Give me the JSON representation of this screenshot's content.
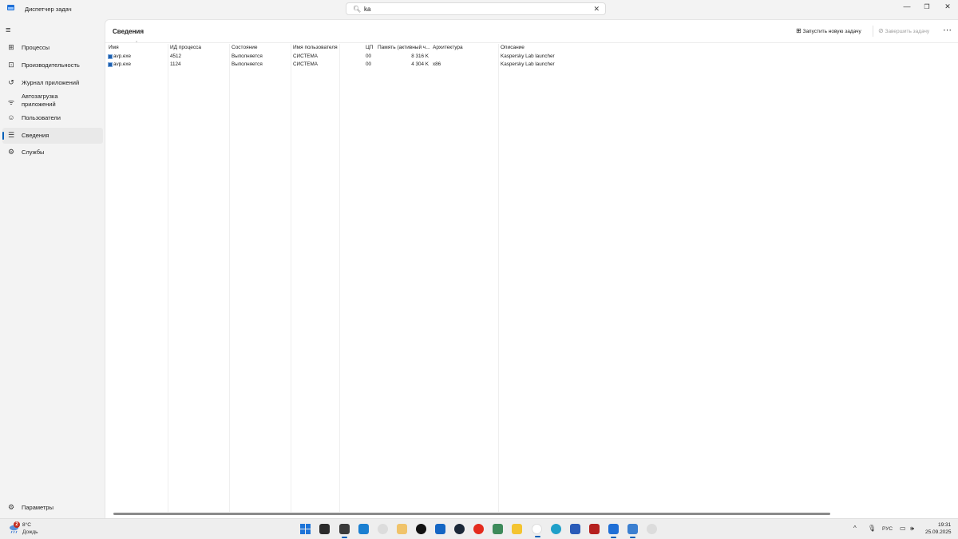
{
  "window": {
    "title": "Диспетчер задач",
    "search_value": "ka"
  },
  "sidebar": {
    "items": [
      {
        "label": "Процессы",
        "icon": "processes-icon"
      },
      {
        "label": "Производительность",
        "icon": "performance-icon"
      },
      {
        "label": "Журнал приложений",
        "icon": "app-history-icon"
      },
      {
        "label": "Автозагрузка приложений",
        "icon": "startup-apps-icon"
      },
      {
        "label": "Пользователи",
        "icon": "users-icon"
      },
      {
        "label": "Сведения",
        "icon": "details-icon",
        "active": true
      },
      {
        "label": "Службы",
        "icon": "services-icon"
      }
    ],
    "settings_label": "Параметры"
  },
  "main": {
    "title": "Сведения",
    "run_task_label": "Запустить новую задачу",
    "end_task_label": "Завершить задачу",
    "columns": [
      "Имя",
      "ИД процесса",
      "Состояние",
      "Имя пользователя",
      "ЦП",
      "Память (активный ч...",
      "Архитектура",
      "Описание"
    ],
    "rows": [
      {
        "name": "avp.exe",
        "pid": "4512",
        "status": "Выполняется",
        "user": "СИСТЕМА",
        "cpu": "00",
        "memory": "8 316 K",
        "arch": "",
        "desc": "Kaspersky Lab launcher"
      },
      {
        "name": "avp.exe",
        "pid": "1124",
        "status": "Выполняется",
        "user": "СИСТЕМА",
        "cpu": "00",
        "memory": "4 304 K",
        "arch": "x86",
        "desc": "Kaspersky Lab launcher"
      }
    ]
  },
  "taskbar": {
    "weather_badge": "2",
    "weather_temp": "8°C",
    "weather_desc": "Дождь",
    "language": "РУС",
    "time": "19:31",
    "date": "25.09.2025",
    "pinned": [
      "windows-start",
      "file-manager",
      "terminal",
      "notes",
      "panda",
      "folder-app",
      "tiktok",
      "store",
      "steam",
      "yandex",
      "game",
      "explorer",
      "yandex-browser",
      "edge",
      "save-app",
      "filezilla",
      "task-manager",
      "notepad",
      "panda-2"
    ]
  },
  "colors": {
    "accent": "#005fb8",
    "badge": "#c42b1c"
  }
}
